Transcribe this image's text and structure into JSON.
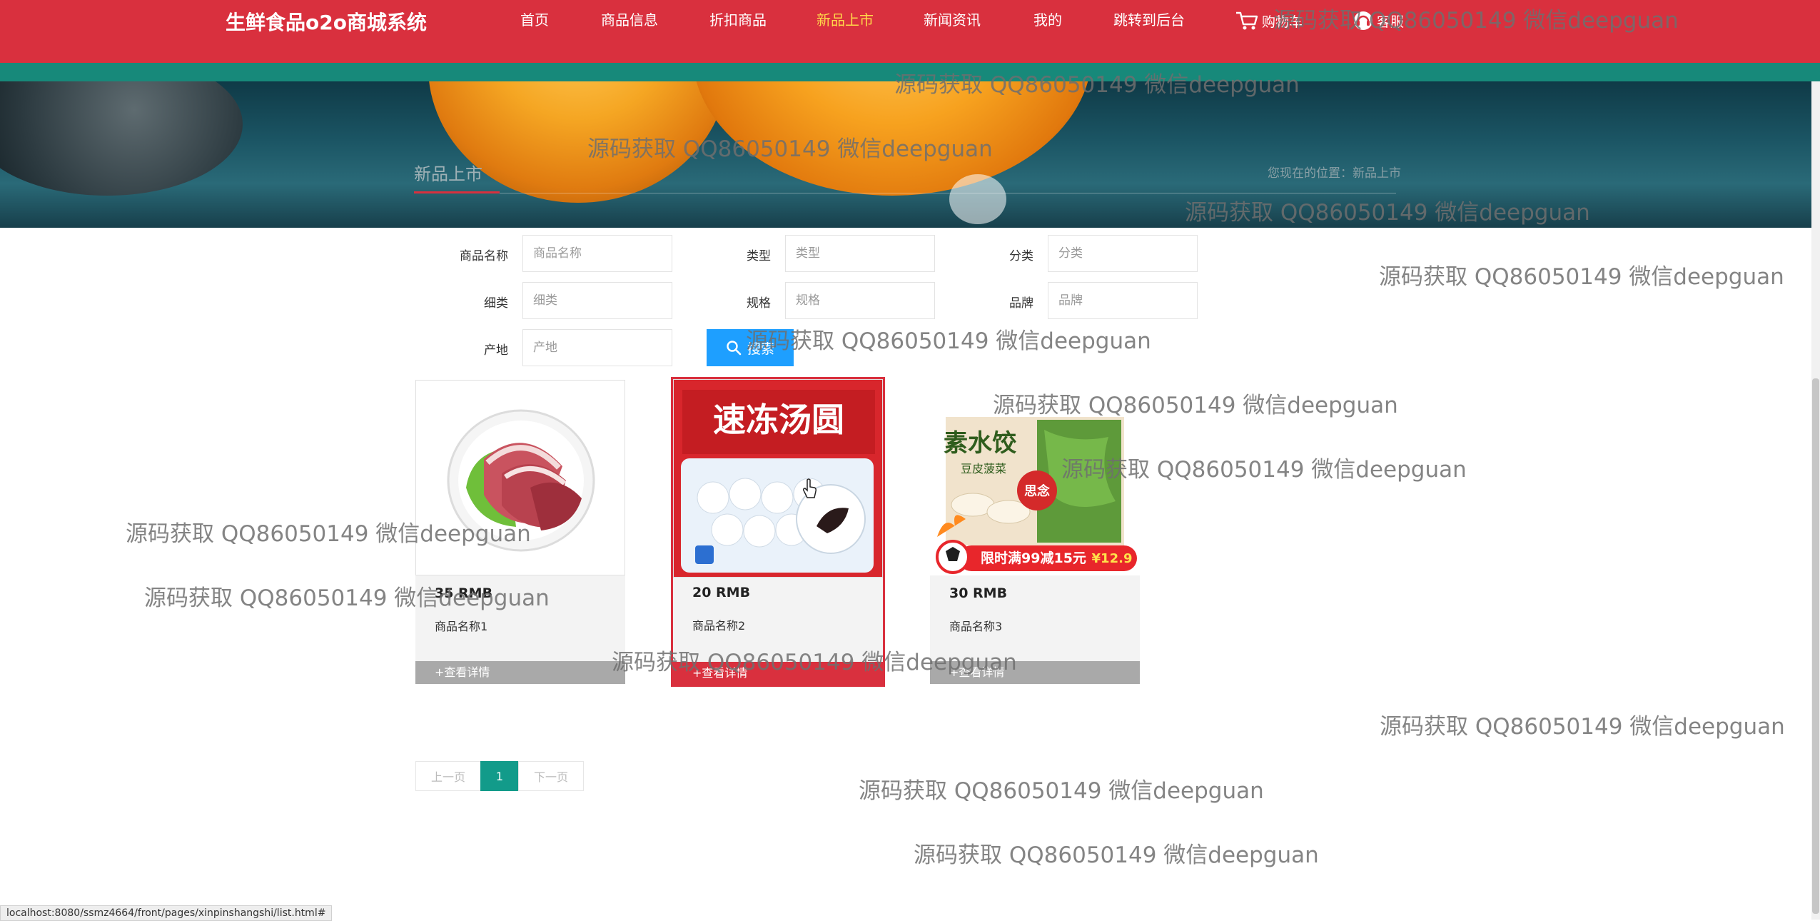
{
  "header": {
    "logo": "生鲜食品o2o商城系统",
    "nav": [
      {
        "label": "首页"
      },
      {
        "label": "商品信息"
      },
      {
        "label": "折扣商品"
      },
      {
        "label": "新品上市"
      },
      {
        "label": "新闻资讯"
      },
      {
        "label": "我的"
      },
      {
        "label": "跳转到后台"
      }
    ],
    "active_nav": "新品上市",
    "cart_label": "购物车",
    "service_label": "客服"
  },
  "banner": {
    "page_title": "新品上市",
    "breadcrumb": "您现在的位置：新品上市"
  },
  "search": {
    "fields": [
      {
        "label": "商品名称",
        "placeholder": "商品名称",
        "value": ""
      },
      {
        "label": "类型",
        "placeholder": "类型",
        "value": ""
      },
      {
        "label": "分类",
        "placeholder": "分类",
        "value": ""
      },
      {
        "label": "细类",
        "placeholder": "细类",
        "value": ""
      },
      {
        "label": "规格",
        "placeholder": "规格",
        "value": ""
      },
      {
        "label": "品牌",
        "placeholder": "品牌",
        "value": ""
      },
      {
        "label": "产地",
        "placeholder": "产地",
        "value": ""
      }
    ],
    "button_label": "搜索"
  },
  "products": [
    {
      "price": "35 RMB",
      "name": "商品名称1",
      "detail": "+查看详情"
    },
    {
      "price": "20 RMB",
      "name": "商品名称2",
      "detail": "+查看详情",
      "package_text": "速冻汤圆"
    },
    {
      "price": "30 RMB",
      "name": "商品名称3",
      "detail": "+查看详情",
      "package_text": "素水饺",
      "promo_text": "限时满99减15元",
      "promo_price": "¥12.9",
      "brand_text": "思念",
      "sub_text": "豆皮菠菜"
    }
  ],
  "pagination": {
    "prev": "上一页",
    "current": "1",
    "next": "下一页"
  },
  "watermark": "源码获取 QQ86050149 微信deepguan",
  "status_url": "localhost:8080/ssmz4664/front/pages/xinpinshangshi/list.html#",
  "colors": {
    "header": "#d9303e",
    "strip": "#17897a",
    "accent_blue": "#1e9fff",
    "page_active": "#129b8a",
    "nav_active": "#ffd84a"
  }
}
